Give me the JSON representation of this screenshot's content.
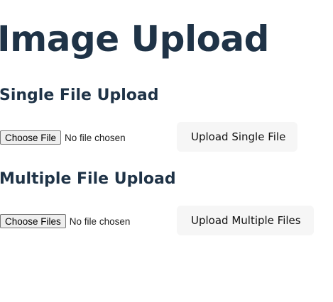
{
  "page": {
    "title": "Image Upload"
  },
  "single_upload": {
    "heading": "Single File Upload",
    "choose_label": "Choose File",
    "status_text": "No file chosen",
    "submit_label": "Upload Single File"
  },
  "multiple_upload": {
    "heading": "Multiple File Upload",
    "choose_label": "Choose Files",
    "status_text": "No file chosen",
    "submit_label": "Upload Multiple Files"
  },
  "colors": {
    "heading": "#1f3347",
    "button_background": "#f6f6f6",
    "file_button_background": "#efefef"
  }
}
